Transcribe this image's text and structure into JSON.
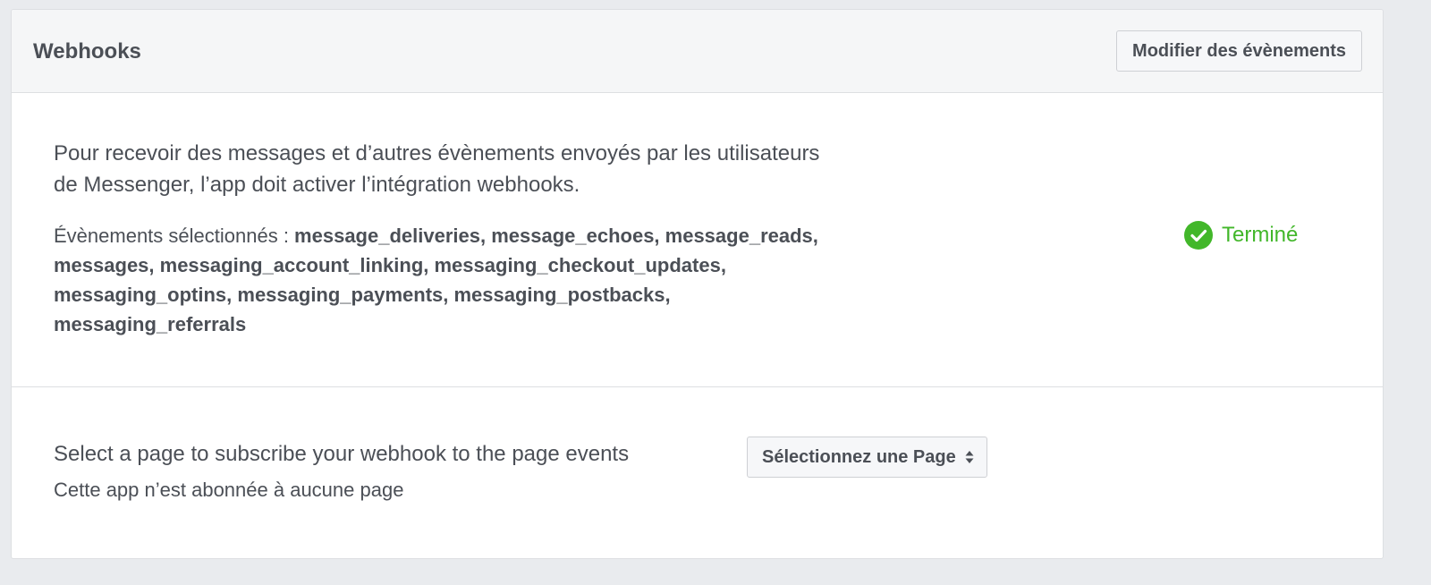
{
  "header": {
    "title": "Webhooks",
    "edit_button_label": "Modifier des évènements"
  },
  "events_section": {
    "intro": "Pour recevoir des messages et d’autres évènements envoyés par les utilisateurs de Messenger, l’app doit activer l’intégration webhooks.",
    "selected_label": "Évènements sélectionnés : ",
    "selected_events": "message_deliveries, message_echoes, message_reads, messages, messaging_account_linking, messaging_checkout_updates, messaging_optins, messaging_payments, messaging_postbacks, messaging_referrals",
    "status_label": "Terminé",
    "status_icon": "check-circle-icon",
    "status_color": "#42b72a"
  },
  "subscribe_section": {
    "text": "Select a page to subscribe your webhook to the page events",
    "note": "Cette app n’est abonnée à aucune page",
    "select_value": "Sélectionnez une Page",
    "select_icon": "sort-arrows-icon"
  }
}
